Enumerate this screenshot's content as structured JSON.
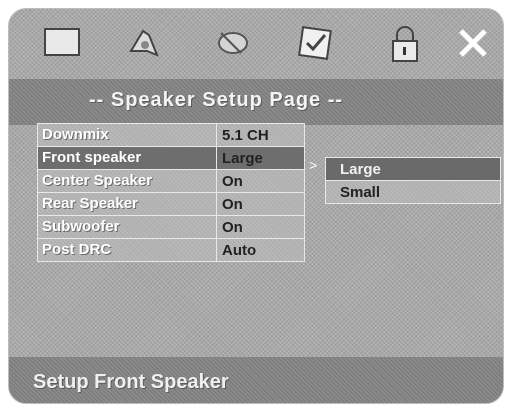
{
  "title": "-- Speaker Setup Page --",
  "tabs": [
    {
      "icon": "screen-icon"
    },
    {
      "icon": "speaker-icon"
    },
    {
      "icon": "dolby-icon"
    },
    {
      "icon": "preference-icon"
    },
    {
      "icon": "lock-icon"
    },
    {
      "icon": "exit-icon"
    }
  ],
  "menu": [
    {
      "label": "Downmix",
      "value": "5.1 CH"
    },
    {
      "label": "Front speaker",
      "value": "Large"
    },
    {
      "label": "Center Speaker",
      "value": "On"
    },
    {
      "label": "Rear Speaker",
      "value": "On"
    },
    {
      "label": "Subwoofer",
      "value": "On"
    },
    {
      "label": "Post DRC",
      "value": "Auto"
    }
  ],
  "submenu": [
    "Large",
    "Small"
  ],
  "selected_menu_index": 1,
  "selected_submenu_index": 0,
  "footer": "Setup Front Speaker",
  "arrow": ">"
}
